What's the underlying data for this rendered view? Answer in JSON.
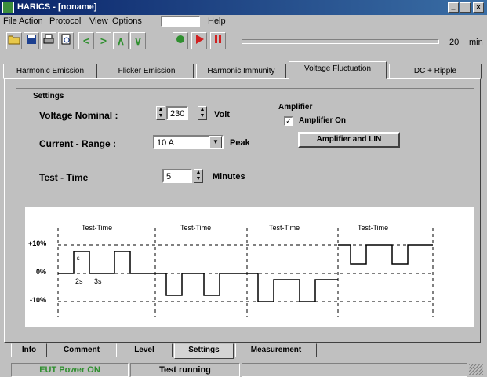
{
  "window": {
    "title": "HARICS - [noname]"
  },
  "menu": {
    "items": [
      "File",
      "Action",
      "Protocol",
      "View",
      "Options",
      "Help"
    ]
  },
  "toolbar": {
    "minutes_value": "20",
    "minutes_unit": "min"
  },
  "top_tabs": [
    "Harmonic Emission",
    "Flicker Emission",
    "Harmonic Immunity",
    "Voltage Fluctuation",
    "DC + Ripple"
  ],
  "settings": {
    "group_label": "Settings",
    "voltage_label": "Voltage Nominal :",
    "voltage_value": "230",
    "voltage_unit": "Volt",
    "current_label": "Current - Range :",
    "current_value": "10 A",
    "current_unit": "Peak",
    "test_time_label": "Test - Time",
    "test_time_value": "5",
    "test_time_unit": "Minutes"
  },
  "amplifier": {
    "label": "Amplifier",
    "checkbox_label": "Amplifier On",
    "checked": true,
    "button_label": "Amplifier and LIN"
  },
  "diagram": {
    "phase_label": "Test-Time",
    "y_labels": [
      "+10%",
      "0%",
      "-10%"
    ],
    "annotations": [
      "2s",
      "3s"
    ],
    "marker": "ε"
  },
  "bottom_tabs": [
    "Info",
    "Comment",
    "Level",
    "Settings",
    "Measurement"
  ],
  "status": {
    "eut": "EUT Power ON",
    "test": "Test running"
  },
  "colors": {
    "title_start": "#0a246a",
    "title_end": "#3a6ea5",
    "status_green": "#2f8f2f"
  }
}
